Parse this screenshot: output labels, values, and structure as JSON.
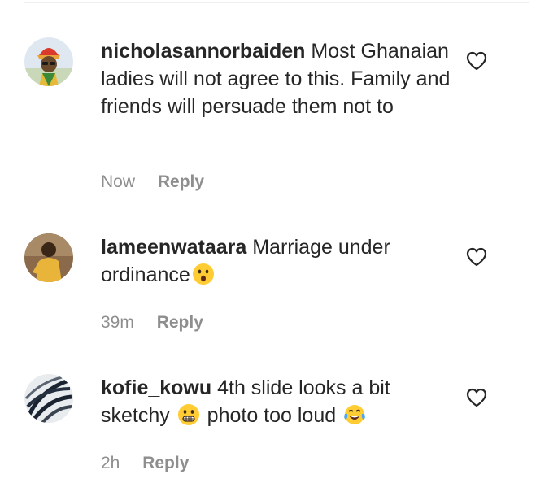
{
  "comments": [
    {
      "username": "nicholasannorbaiden",
      "text": "Most Ghanaian ladies will not agree to this. Family and friends will persuade them not to",
      "time": "Now",
      "reply_label": "Reply"
    },
    {
      "username": "lameenwataara",
      "text": "Marriage under ordinance",
      "emoji_1": "hushed-face",
      "time": "39m",
      "reply_label": "Reply"
    },
    {
      "username": "kofie_kowu",
      "text_part1": "4th slide looks a bit sketchy",
      "emoji_1": "grimacing-face",
      "text_part2": "photo too loud",
      "emoji_2": "tears-of-joy-face",
      "time": "2h",
      "reply_label": "Reply"
    }
  ],
  "icons": {
    "like": "heart-outline-icon"
  },
  "colors": {
    "text": "#262626",
    "muted": "#8e8e8e",
    "emoji_yellow": "#ffcc33",
    "tear_blue": "#4aa8e8"
  }
}
